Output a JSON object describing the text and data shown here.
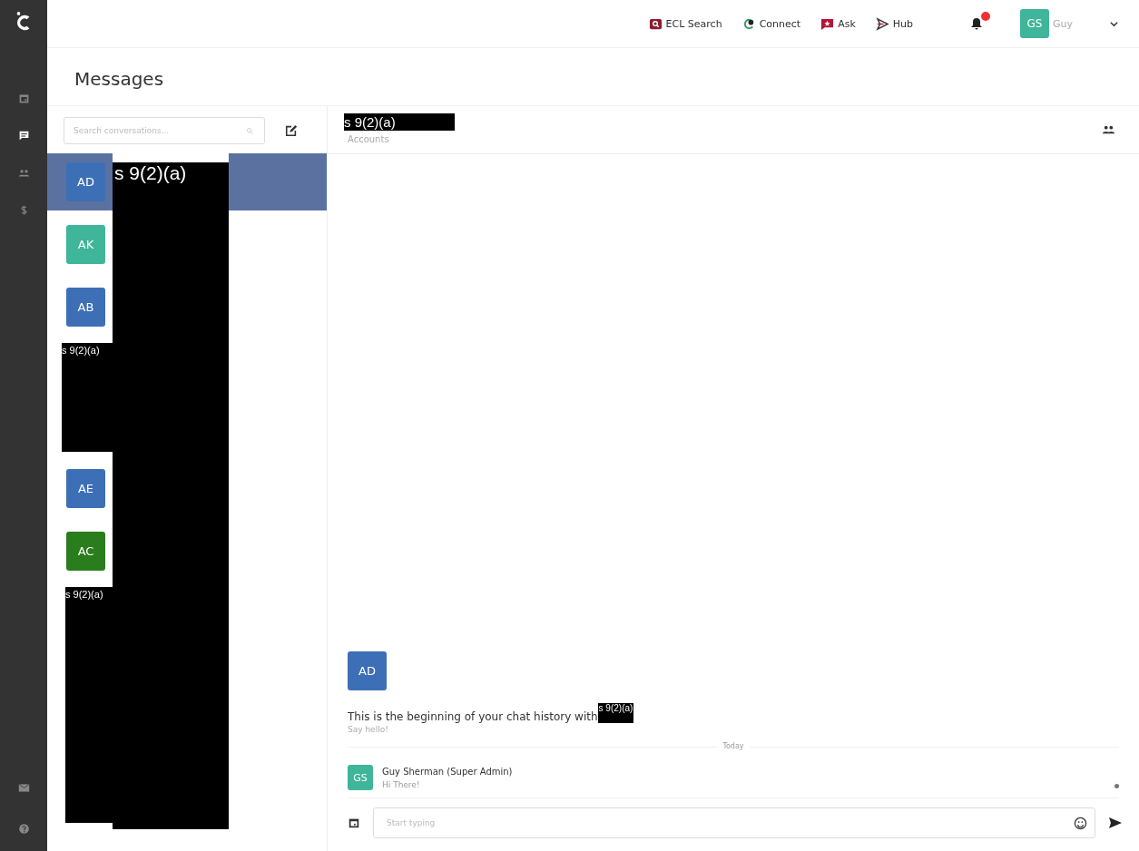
{
  "rail": {
    "items": [
      {
        "kind": "calendar",
        "selected": false
      },
      {
        "kind": "chat",
        "selected": true
      },
      {
        "kind": "people",
        "selected": false
      },
      {
        "kind": "dollar",
        "selected": false
      }
    ],
    "bottom": [
      {
        "kind": "mail",
        "selected": false
      },
      {
        "kind": "help",
        "selected": false
      }
    ]
  },
  "topbar": {
    "links": [
      {
        "kind": "search",
        "label": "ECL Search"
      },
      {
        "kind": "connect",
        "label": "Connect"
      },
      {
        "kind": "ask",
        "label": "Ask"
      },
      {
        "kind": "hub",
        "label": "Hub"
      }
    ],
    "notifications": {
      "badge": true
    },
    "user": {
      "initials": "GS",
      "name": "Guy"
    }
  },
  "page_title": "Messages",
  "search": {
    "placeholder": "Search conversations..."
  },
  "conversations": [
    {
      "kind": "contact",
      "initials": "AD",
      "color": "#3d6fb6",
      "selected": true
    },
    {
      "kind": "contact",
      "initials": "AK",
      "color": "#3fb59a",
      "selected": false
    },
    {
      "kind": "contact",
      "initials": "AB",
      "color": "#3d6fb6",
      "selected": false
    },
    {
      "kind": "redaction",
      "label": "s 9(2)(a)"
    },
    {
      "kind": "contact",
      "initials": "AE",
      "color": "#3d6fb6",
      "selected": false
    },
    {
      "kind": "contact",
      "initials": "AC",
      "color": "#2a7d1c",
      "selected": false
    },
    {
      "kind": "redaction",
      "label": "s 9(2)(a)"
    }
  ],
  "name_redaction": {
    "label": "s 9(2)(a)"
  },
  "chat": {
    "title_redaction": "s 9(2)(a)",
    "subtitle": "Accounts",
    "intro": {
      "initials": "AD",
      "color": "#3d6fb6",
      "text": "This is the beginning of your chat history with",
      "redaction": "s 9(2)(a)",
      "hint": "Say hello!"
    },
    "divider": "Today",
    "messages": [
      {
        "initials": "GS",
        "color": "#3fb59a",
        "author": "Guy Sherman (Super Admin)",
        "text": "Hi There!"
      }
    ],
    "composer": {
      "placeholder": "Start typing"
    }
  }
}
